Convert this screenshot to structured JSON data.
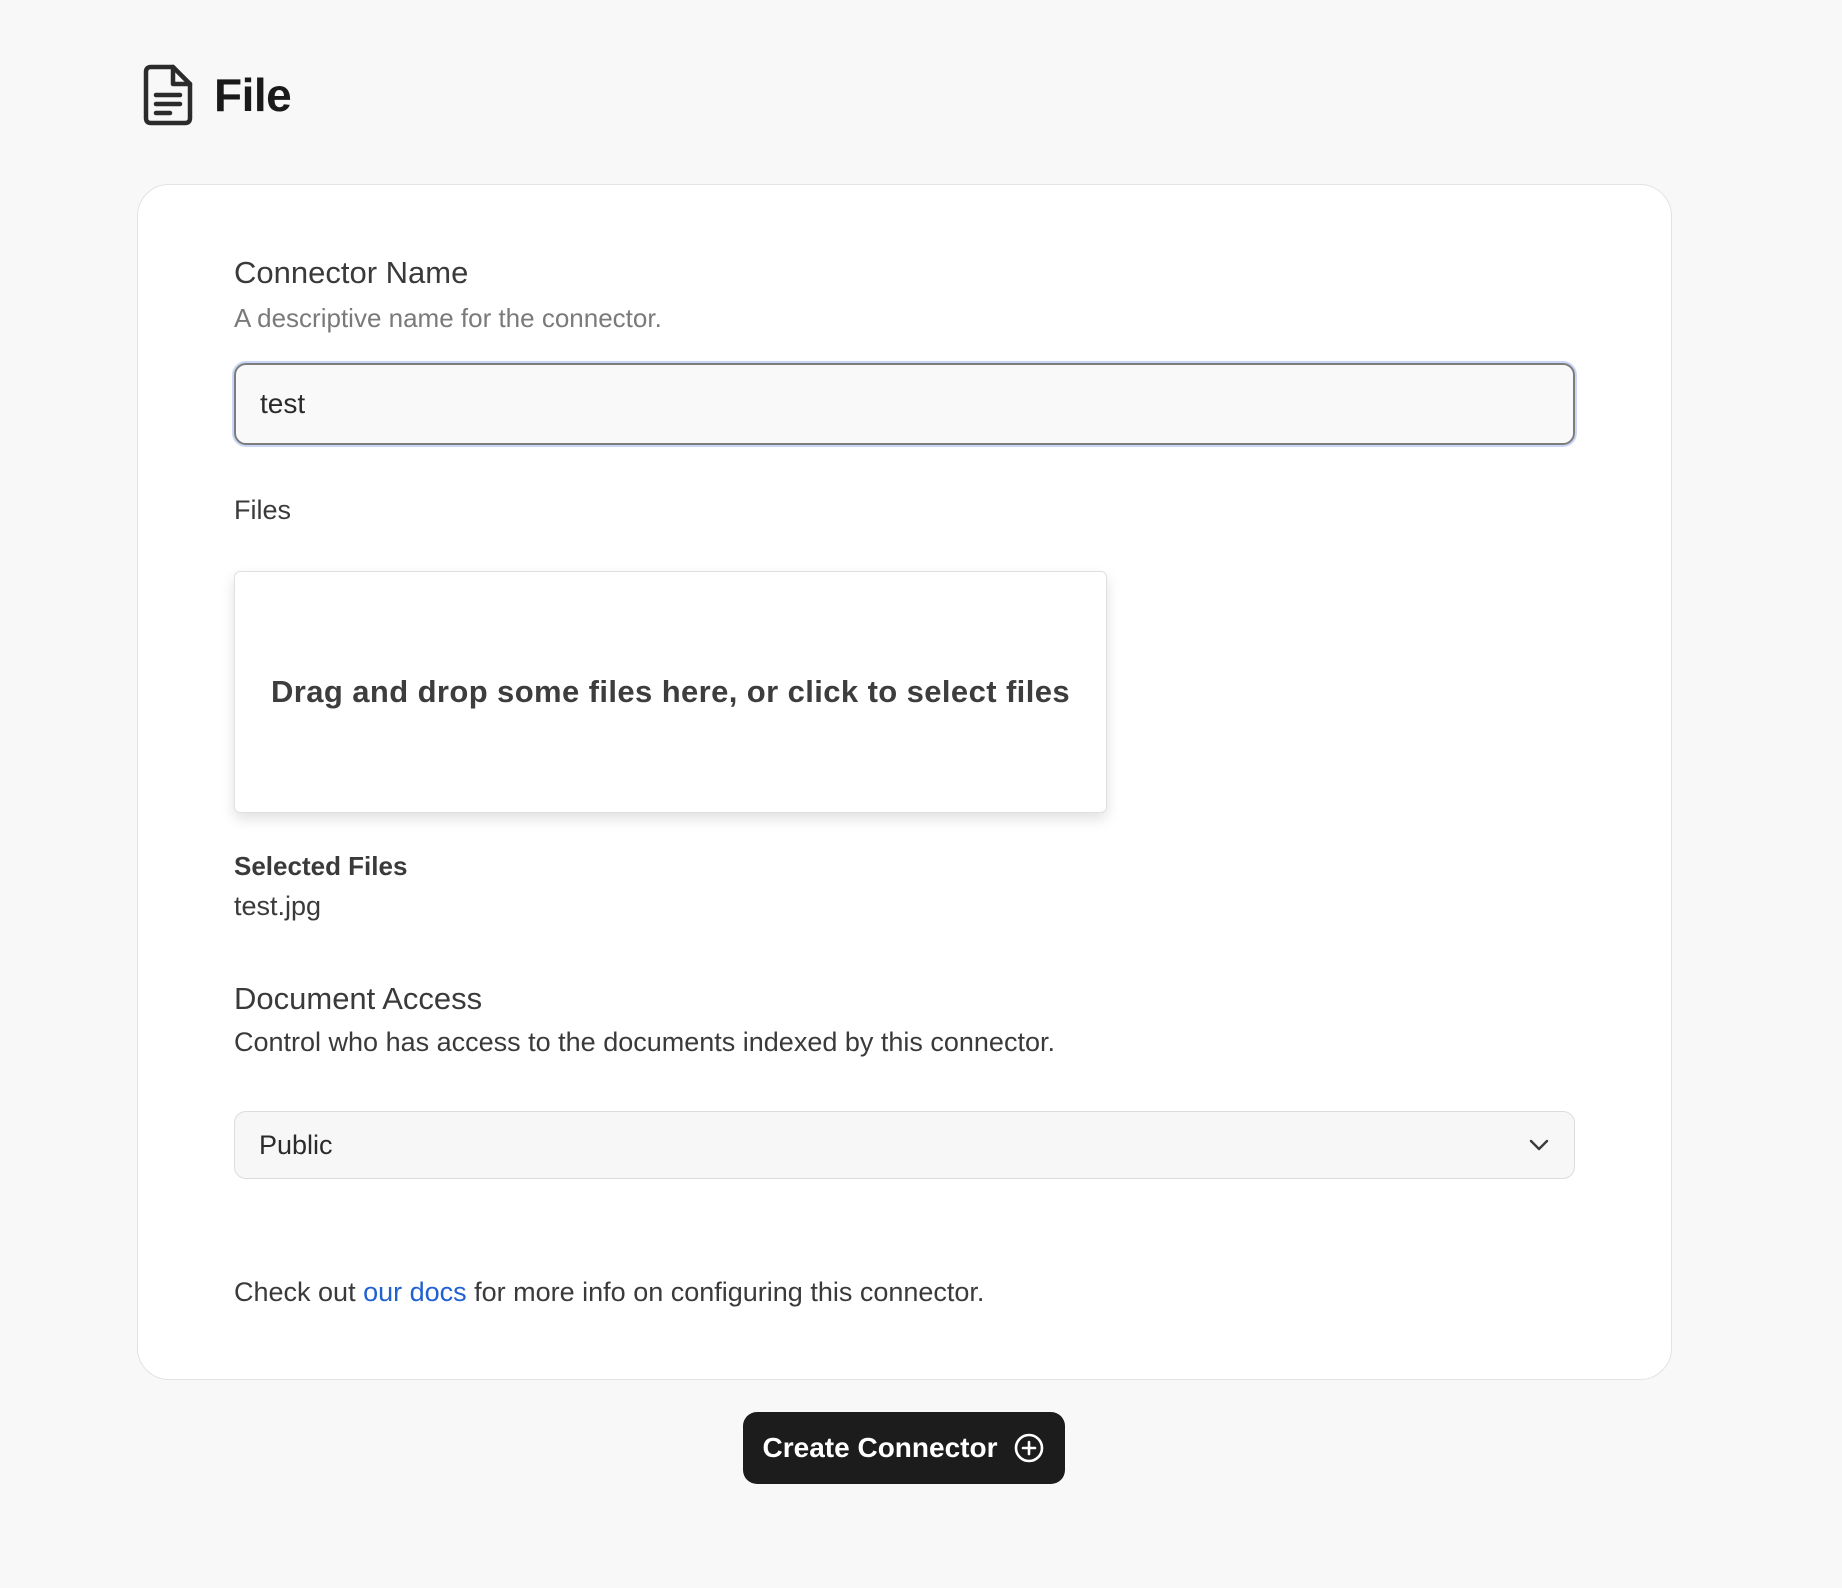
{
  "header": {
    "icon": "file-text-icon",
    "title": "File"
  },
  "form": {
    "connector_name": {
      "label": "Connector Name",
      "description": "A descriptive name for the connector.",
      "value": "test"
    },
    "files": {
      "label": "Files",
      "dropzone_text": "Drag and drop some files here, or click to select files",
      "selected_label": "Selected Files",
      "selected_files": [
        "test.jpg"
      ]
    },
    "document_access": {
      "label": "Document Access",
      "description": "Control who has access to the documents indexed by this connector.",
      "selected": "Public",
      "icon": "chevron-down-icon"
    },
    "docs_note": {
      "prefix": "Check out ",
      "link_text": "our docs",
      "suffix": " for more info on configuring this connector."
    }
  },
  "actions": {
    "create_label": "Create Connector",
    "create_icon": "plus-circle-icon"
  },
  "colors": {
    "background": "#f8f8f8",
    "card": "#ffffff",
    "link": "#2160d1",
    "button": "#1c1c1c",
    "focus_ring": "#c9d6f5"
  }
}
